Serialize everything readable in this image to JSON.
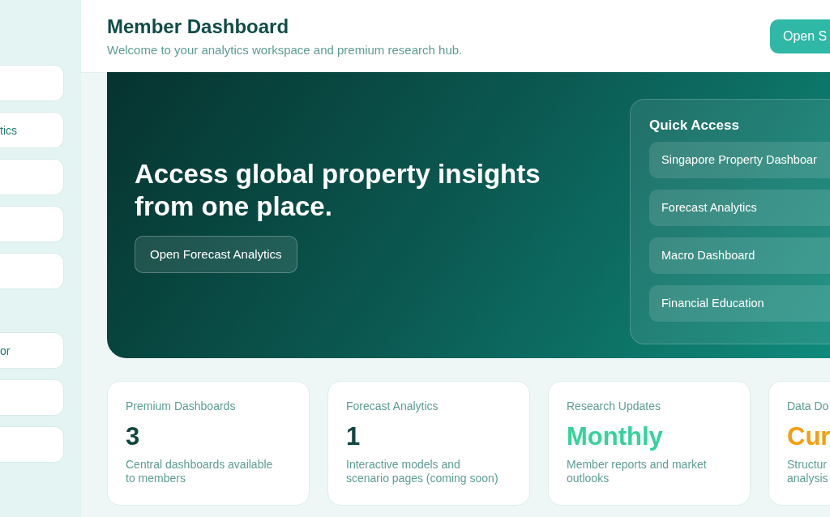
{
  "sidebar": {
    "groups": [
      {
        "items": [
          {
            "kind": "blank"
          },
          {
            "kind": "link",
            "label": "tics"
          },
          {
            "kind": "blank"
          },
          {
            "kind": "blank"
          },
          {
            "kind": "blank"
          }
        ]
      },
      {
        "items": [
          {
            "kind": "link",
            "label": "or"
          },
          {
            "kind": "blank"
          },
          {
            "kind": "blank"
          }
        ]
      }
    ]
  },
  "header": {
    "title": "Member Dashboard",
    "subtitle": "Welcome to your analytics workspace and premium research hub.",
    "button": "Open S"
  },
  "hero": {
    "headline": "Access global property insights from one place.",
    "button": "Open Forecast Analytics",
    "quick_access": {
      "title": "Quick Access",
      "items": [
        "Singapore Property Dashboar",
        "Forecast Analytics",
        "Macro Dashboard",
        "Financial Education"
      ]
    }
  },
  "stats": [
    {
      "label": "Premium Dashboards",
      "value": "3",
      "color": "#12453f",
      "description": "Central dashboards available to members"
    },
    {
      "label": "Forecast Analytics",
      "value": "1",
      "color": "#12453f",
      "description": "Interactive models and scenario pages (coming soon)"
    },
    {
      "label": "Research Updates",
      "value": "Monthly",
      "color": "#34d399",
      "description": "Member reports and market outlooks"
    },
    {
      "label": "Data Do",
      "value": "Cur",
      "color": "#f59e0b",
      "description": "Structur analysis"
    }
  ]
}
